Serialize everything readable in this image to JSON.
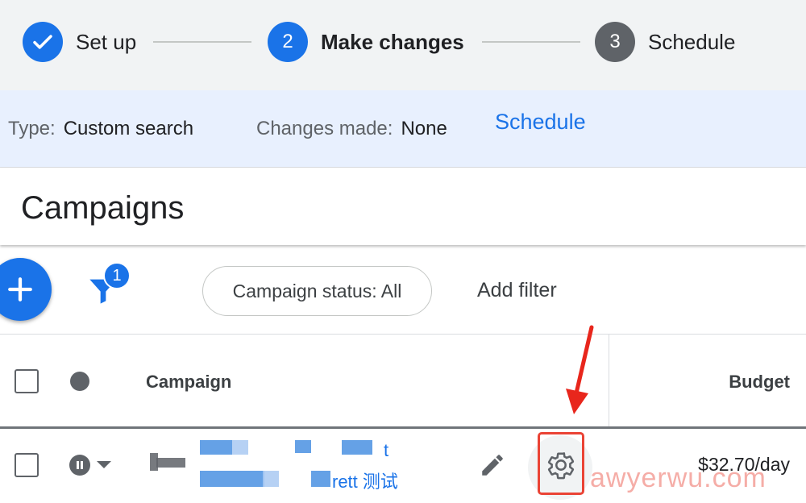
{
  "stepper": {
    "steps": [
      {
        "label": "Set up",
        "state": "done",
        "number": ""
      },
      {
        "label": "Make changes",
        "state": "active",
        "number": "2"
      },
      {
        "label": "Schedule",
        "state": "todo",
        "number": "3"
      }
    ]
  },
  "infobar": {
    "type_key": "Type:",
    "type_value": "Custom search",
    "changes_key": "Changes made:",
    "changes_value": "None",
    "schedule_link": "Schedule"
  },
  "page": {
    "title": "Campaigns"
  },
  "toolbar": {
    "add_icon": "plus-icon",
    "filter_icon": "filter-icon",
    "filter_count": "1",
    "status_chip": "Campaign status: All",
    "add_filter": "Add filter"
  },
  "table": {
    "headers": {
      "campaign": "Campaign",
      "budget": "Budget"
    },
    "row": {
      "status_icon": "pause-icon",
      "name_fragment_1": "t",
      "name_fragment_2": "rett 测试",
      "budget": "$32.70/day"
    }
  },
  "annotation": {
    "watermark": "awyerwu.com",
    "highlight_color": "#ea4335"
  },
  "colors": {
    "accent": "#1a73e8",
    "info_bg": "#e8f0fe",
    "stepper_bg": "#f1f3f4"
  }
}
